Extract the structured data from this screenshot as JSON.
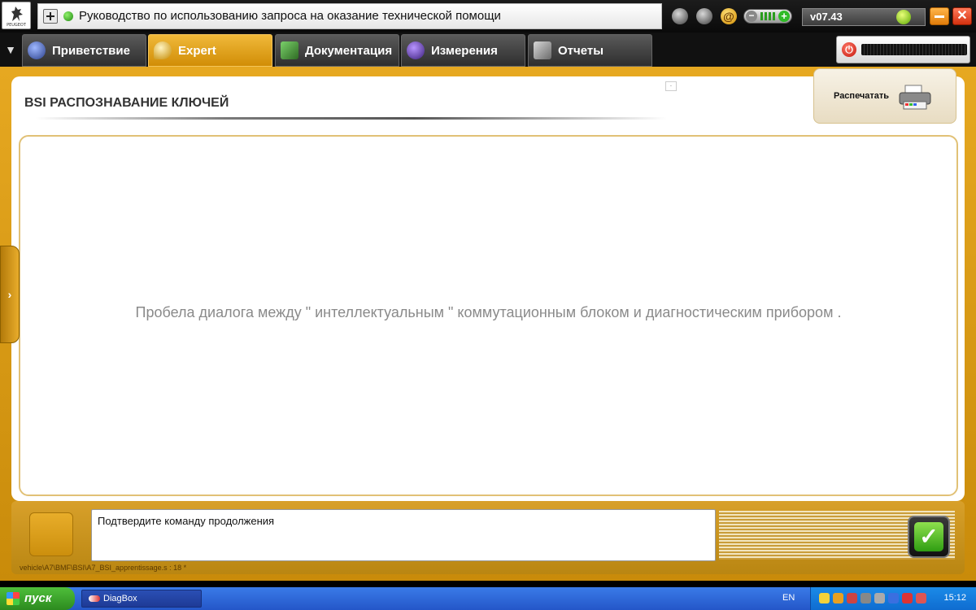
{
  "window": {
    "brand": "PEUGEOT",
    "help_title": "Руководство по использованию запроса на оказание технической помощи",
    "version": "v07.43"
  },
  "tabs": [
    {
      "label": "Приветствие",
      "active": false,
      "icon": "globe-icon"
    },
    {
      "label": "Expert",
      "active": true,
      "icon": "magnifier-icon"
    },
    {
      "label": "Документация",
      "active": false,
      "icon": "book-icon"
    },
    {
      "label": "Измерения",
      "active": false,
      "icon": "waveform-icon"
    },
    {
      "label": "Отчеты",
      "active": false,
      "icon": "report-icon"
    }
  ],
  "main": {
    "title": "BSI  РАСПОЗНАВАНИЕ КЛЮЧЕЙ",
    "print_label": "Распечатать",
    "message": "Пробела диалога между \" интеллектуальным \" коммутационным блоком и диагностическим прибором ."
  },
  "command": {
    "prompt": "Подтвердите команду продолжения",
    "script_path": "vehicle\\A7\\BMF\\BSI\\A7_BSI_apprentissage.s : 18 *"
  },
  "taskbar": {
    "start_label": "пуск",
    "task_item": "DiagBox",
    "language": "EN",
    "clock": "15:12"
  },
  "colors": {
    "accent": "#e6a821",
    "active_tab": "#d18d06",
    "taskbar": "#2456c8"
  }
}
